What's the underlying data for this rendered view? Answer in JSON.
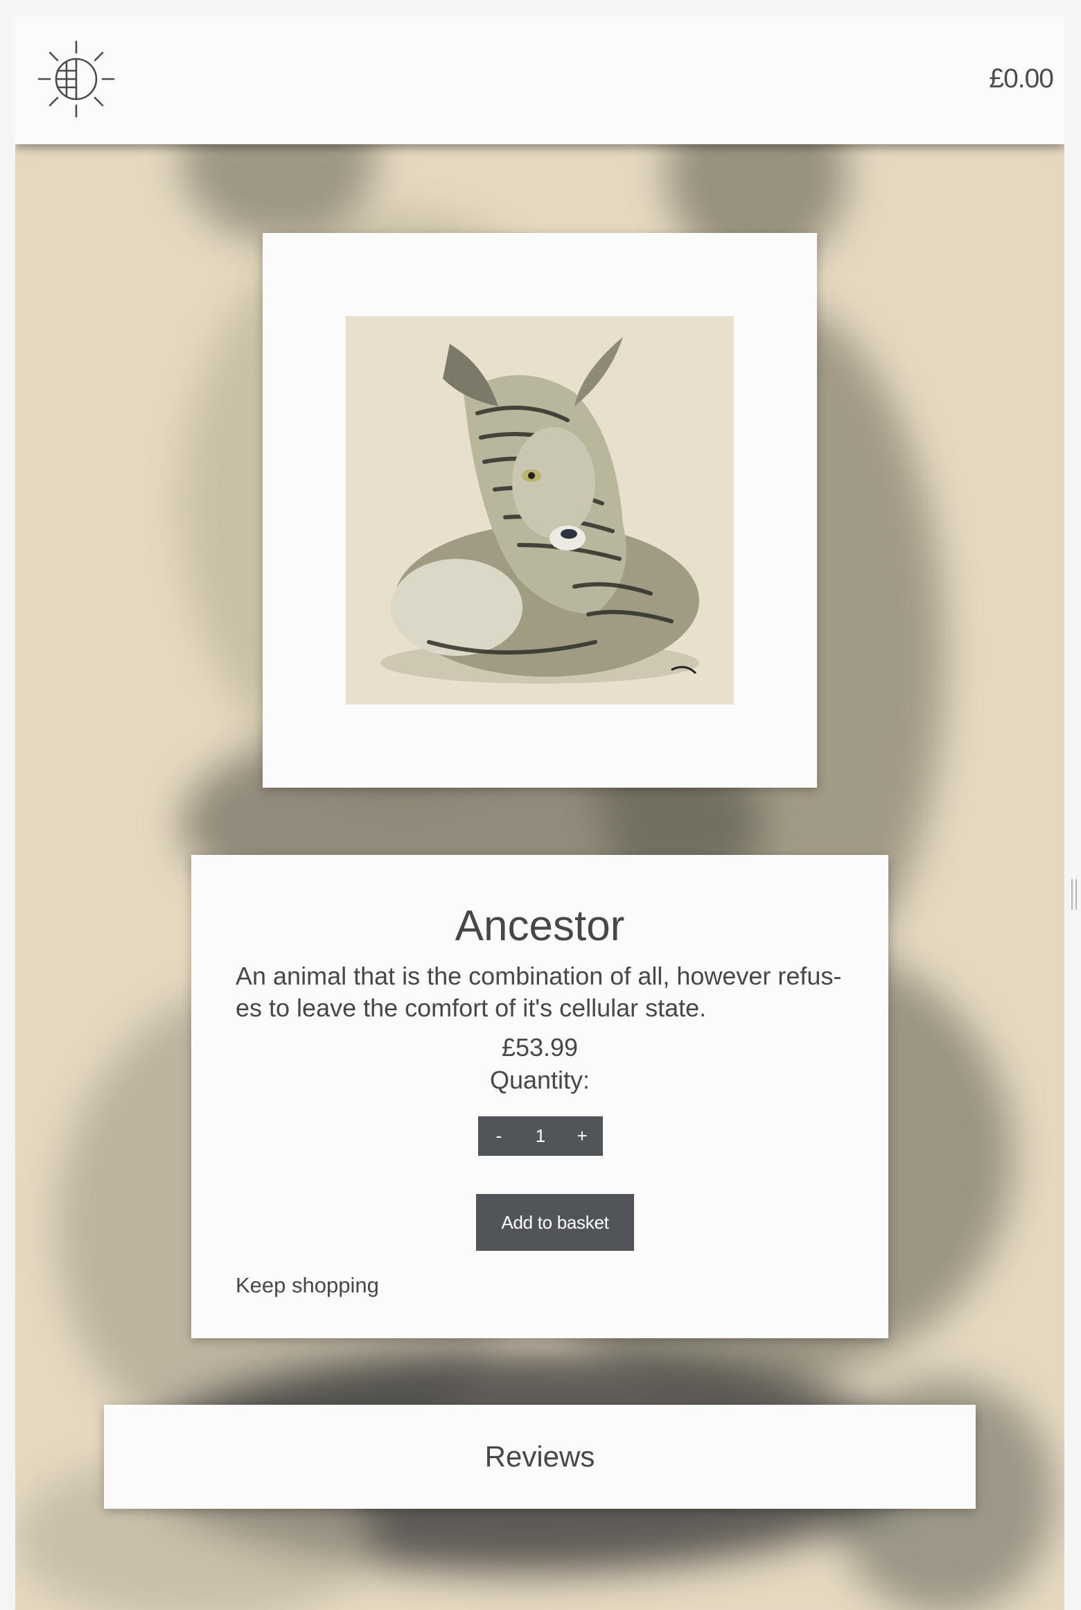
{
  "header": {
    "logo_icon": "sun-globe-logo-icon",
    "basket_total": "£0.00"
  },
  "product": {
    "title": "Ancestor",
    "description": "An animal that is the combination of all, however refus- es to leave the comfort of it's cellular state.",
    "price": "£53.99",
    "quantity_label": "Quantity:",
    "quantity_value": "1",
    "decrement_label": "-",
    "increment_label": "+",
    "add_to_basket_label": "Add to basket",
    "keep_shopping_label": "Keep shopping",
    "image_icon": "curled-striped-animal-artwork"
  },
  "reviews": {
    "title": "Reviews"
  },
  "colors": {
    "button_bg": "#515459",
    "card_bg": "#fbfbfb",
    "text": "#45474b",
    "backdrop": "#e6dbc4"
  }
}
